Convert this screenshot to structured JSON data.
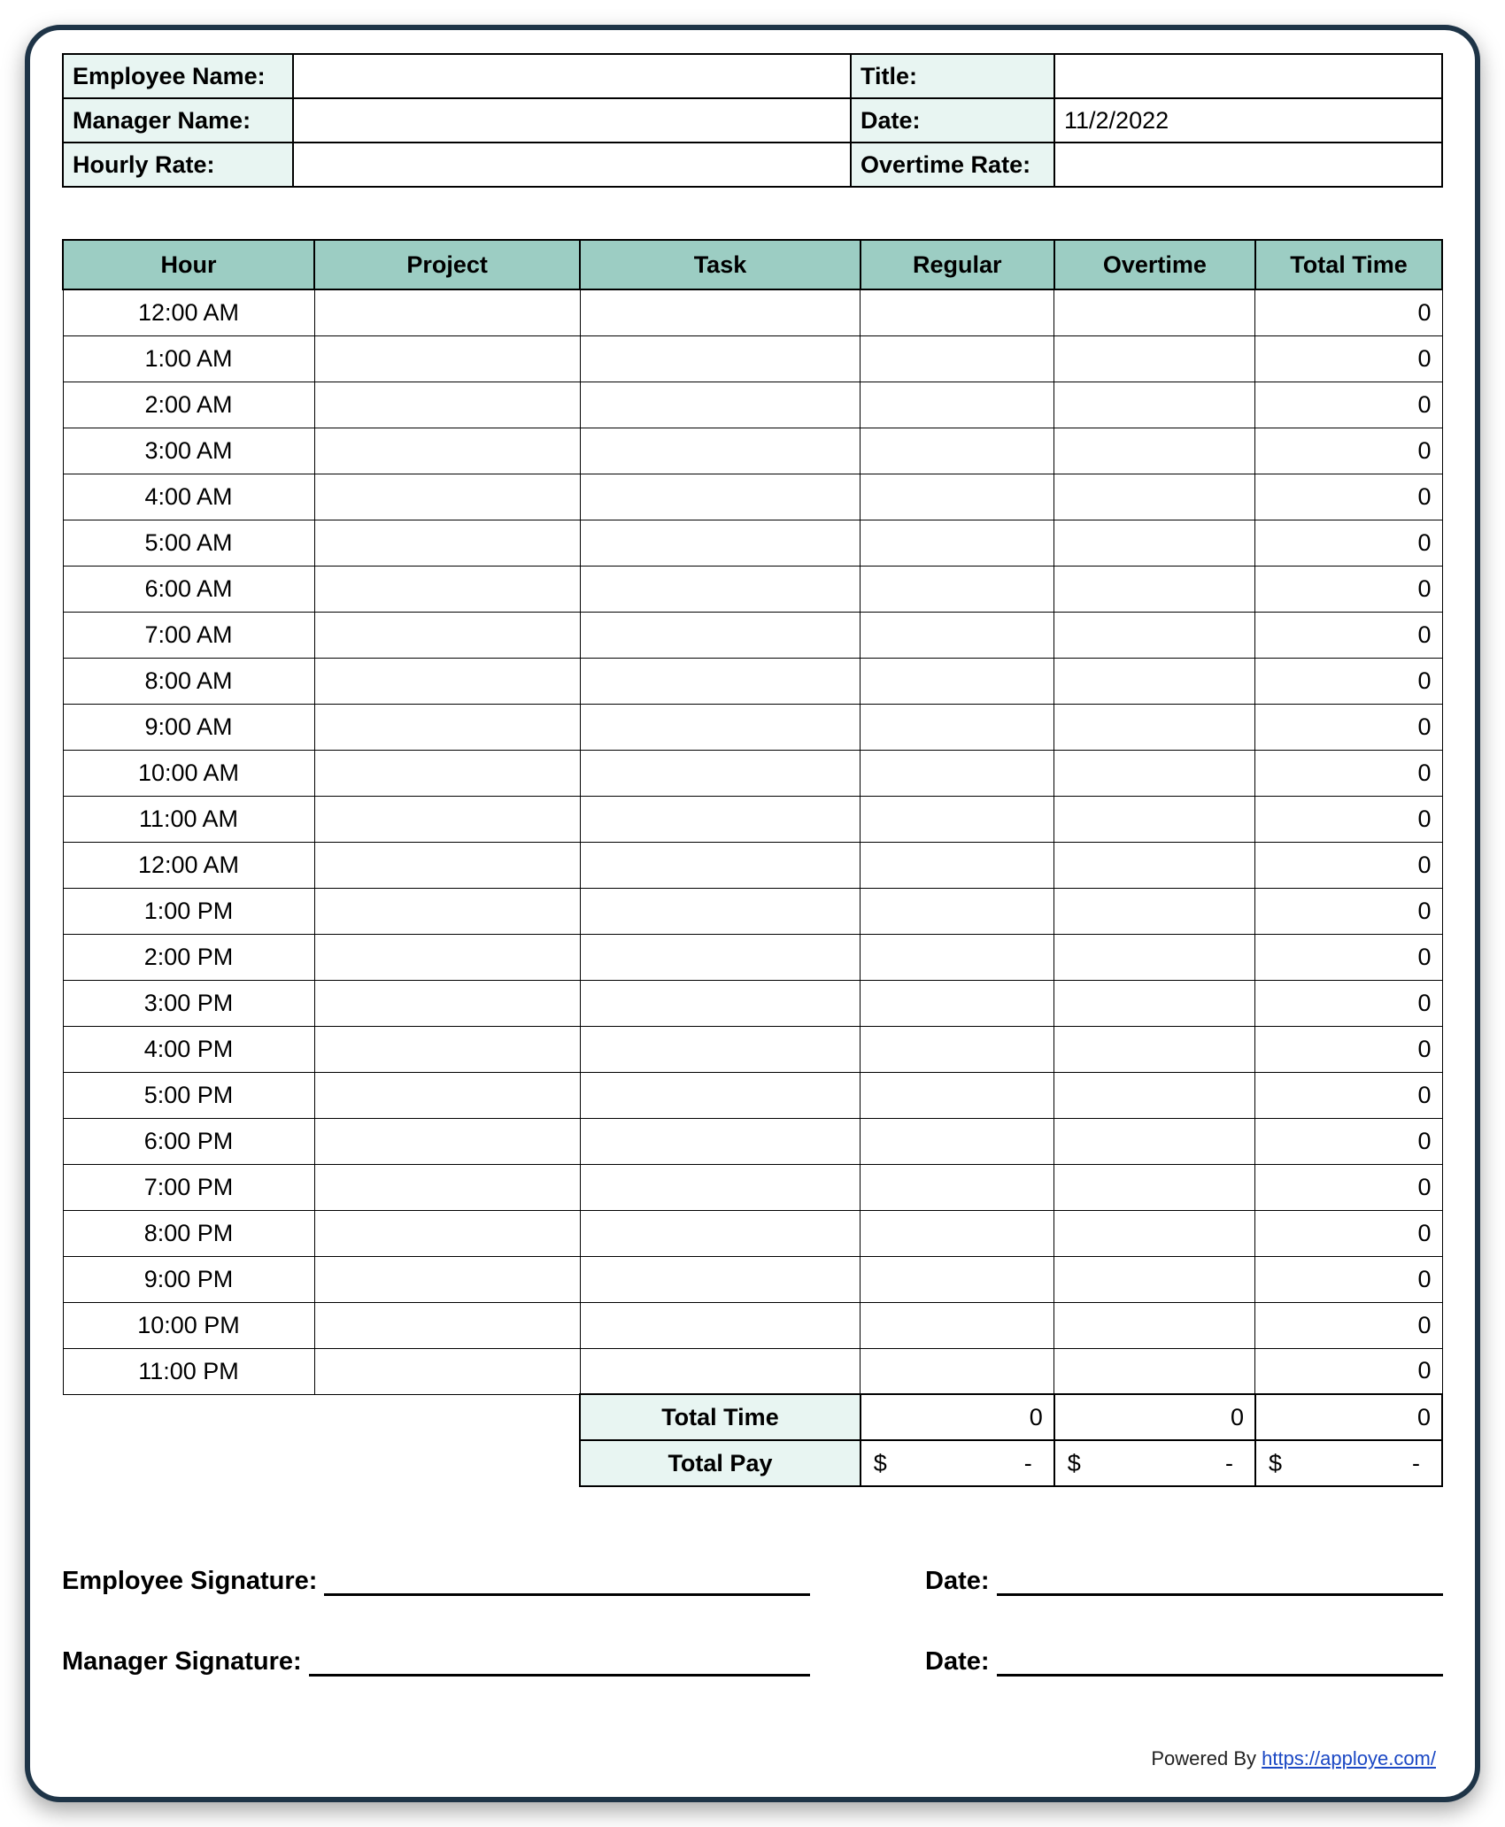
{
  "info": {
    "employee_name_label": "Employee Name:",
    "employee_name_value": "",
    "title_label": "Title:",
    "title_value": "",
    "manager_name_label": "Manager Name:",
    "manager_name_value": "",
    "date_label": "Date:",
    "date_value": "11/2/2022",
    "hourly_rate_label": "Hourly Rate:",
    "hourly_rate_value": "",
    "overtime_rate_label": "Overtime Rate:",
    "overtime_rate_value": ""
  },
  "columns": {
    "hour": "Hour",
    "project": "Project",
    "task": "Task",
    "regular": "Regular",
    "overtime": "Overtime",
    "total_time": "Total Time"
  },
  "rows": [
    {
      "hour": "12:00 AM",
      "project": "",
      "task": "",
      "regular": "",
      "overtime": "",
      "total": "0"
    },
    {
      "hour": "1:00 AM",
      "project": "",
      "task": "",
      "regular": "",
      "overtime": "",
      "total": "0"
    },
    {
      "hour": "2:00 AM",
      "project": "",
      "task": "",
      "regular": "",
      "overtime": "",
      "total": "0"
    },
    {
      "hour": "3:00 AM",
      "project": "",
      "task": "",
      "regular": "",
      "overtime": "",
      "total": "0"
    },
    {
      "hour": "4:00 AM",
      "project": "",
      "task": "",
      "regular": "",
      "overtime": "",
      "total": "0"
    },
    {
      "hour": "5:00 AM",
      "project": "",
      "task": "",
      "regular": "",
      "overtime": "",
      "total": "0"
    },
    {
      "hour": "6:00 AM",
      "project": "",
      "task": "",
      "regular": "",
      "overtime": "",
      "total": "0"
    },
    {
      "hour": "7:00 AM",
      "project": "",
      "task": "",
      "regular": "",
      "overtime": "",
      "total": "0"
    },
    {
      "hour": "8:00 AM",
      "project": "",
      "task": "",
      "regular": "",
      "overtime": "",
      "total": "0"
    },
    {
      "hour": "9:00 AM",
      "project": "",
      "task": "",
      "regular": "",
      "overtime": "",
      "total": "0"
    },
    {
      "hour": "10:00 AM",
      "project": "",
      "task": "",
      "regular": "",
      "overtime": "",
      "total": "0"
    },
    {
      "hour": "11:00 AM",
      "project": "",
      "task": "",
      "regular": "",
      "overtime": "",
      "total": "0"
    },
    {
      "hour": "12:00 AM",
      "project": "",
      "task": "",
      "regular": "",
      "overtime": "",
      "total": "0"
    },
    {
      "hour": "1:00 PM",
      "project": "",
      "task": "",
      "regular": "",
      "overtime": "",
      "total": "0"
    },
    {
      "hour": "2:00 PM",
      "project": "",
      "task": "",
      "regular": "",
      "overtime": "",
      "total": "0"
    },
    {
      "hour": "3:00 PM",
      "project": "",
      "task": "",
      "regular": "",
      "overtime": "",
      "total": "0"
    },
    {
      "hour": "4:00 PM",
      "project": "",
      "task": "",
      "regular": "",
      "overtime": "",
      "total": "0"
    },
    {
      "hour": "5:00 PM",
      "project": "",
      "task": "",
      "regular": "",
      "overtime": "",
      "total": "0"
    },
    {
      "hour": "6:00 PM",
      "project": "",
      "task": "",
      "regular": "",
      "overtime": "",
      "total": "0"
    },
    {
      "hour": "7:00 PM",
      "project": "",
      "task": "",
      "regular": "",
      "overtime": "",
      "total": "0"
    },
    {
      "hour": "8:00 PM",
      "project": "",
      "task": "",
      "regular": "",
      "overtime": "",
      "total": "0"
    },
    {
      "hour": "9:00 PM",
      "project": "",
      "task": "",
      "regular": "",
      "overtime": "",
      "total": "0"
    },
    {
      "hour": "10:00 PM",
      "project": "",
      "task": "",
      "regular": "",
      "overtime": "",
      "total": "0"
    },
    {
      "hour": "11:00 PM",
      "project": "",
      "task": "",
      "regular": "",
      "overtime": "",
      "total": "0"
    }
  ],
  "summary": {
    "total_time_label": "Total Time",
    "total_time_regular": "0",
    "total_time_overtime": "0",
    "total_time_total": "0",
    "total_pay_label": "Total Pay",
    "pay_symbol": "$",
    "pay_dash": "-"
  },
  "signatures": {
    "employee_label": "Employee Signature:",
    "manager_label": "Manager Signature:",
    "date_label": "Date:"
  },
  "footer": {
    "powered_by": "Powered By ",
    "link_text": "https://apploye.com/"
  }
}
